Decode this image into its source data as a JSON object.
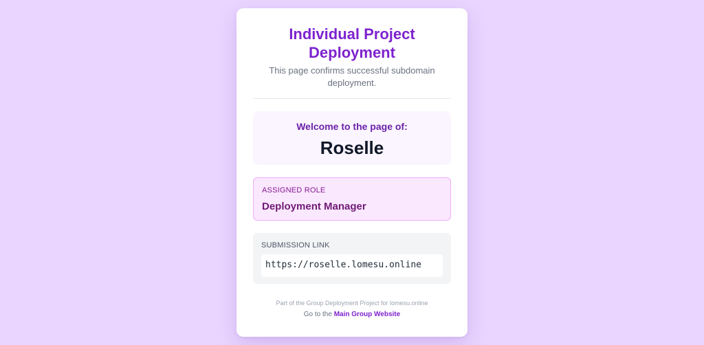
{
  "colors": {
    "page_background": "#e9d5ff",
    "accent": "#7e22ce",
    "role_background": "#fae8ff",
    "welcome_background": "#faf5ff"
  },
  "header": {
    "title": "Individual Project Deployment",
    "subtitle": "This page confirms successful subdomain deployment."
  },
  "welcome": {
    "label": "Welcome to the page of:",
    "name": "Roselle"
  },
  "role": {
    "label": "ASSIGNED ROLE",
    "value": "Deployment Manager"
  },
  "submission": {
    "label": "SUBMISSION LINK",
    "url": "https://roselle.lomesu.online"
  },
  "footer": {
    "note": "Part of the Group Deployment Project for lomesu.online",
    "goto_prefix": "Go to the",
    "link_label": "Main Group Website"
  }
}
